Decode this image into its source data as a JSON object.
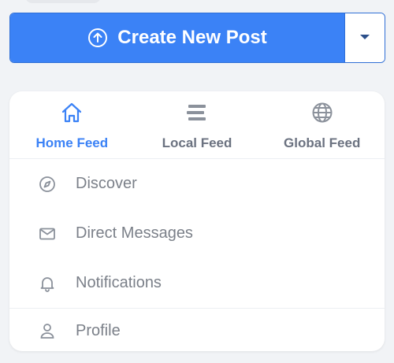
{
  "create_post": {
    "label": "Create New Post",
    "icon": "arrow-up-circle-icon",
    "dropdown_icon": "caret-down-icon",
    "color": "#3b82f6"
  },
  "tabs": [
    {
      "label": "Home Feed",
      "icon": "home-icon",
      "active": true
    },
    {
      "label": "Local Feed",
      "icon": "bars-icon",
      "active": false
    },
    {
      "label": "Global Feed",
      "icon": "globe-icon",
      "active": false
    }
  ],
  "menu": {
    "items": [
      {
        "label": "Discover",
        "icon": "compass-icon"
      },
      {
        "label": "Direct Messages",
        "icon": "mail-icon"
      },
      {
        "label": "Notifications",
        "icon": "bell-icon"
      },
      {
        "label": "Profile",
        "icon": "user-icon"
      }
    ]
  },
  "colors": {
    "accent": "#3b82f6",
    "muted_text": "#7b8089",
    "tab_text": "#6b7280"
  }
}
